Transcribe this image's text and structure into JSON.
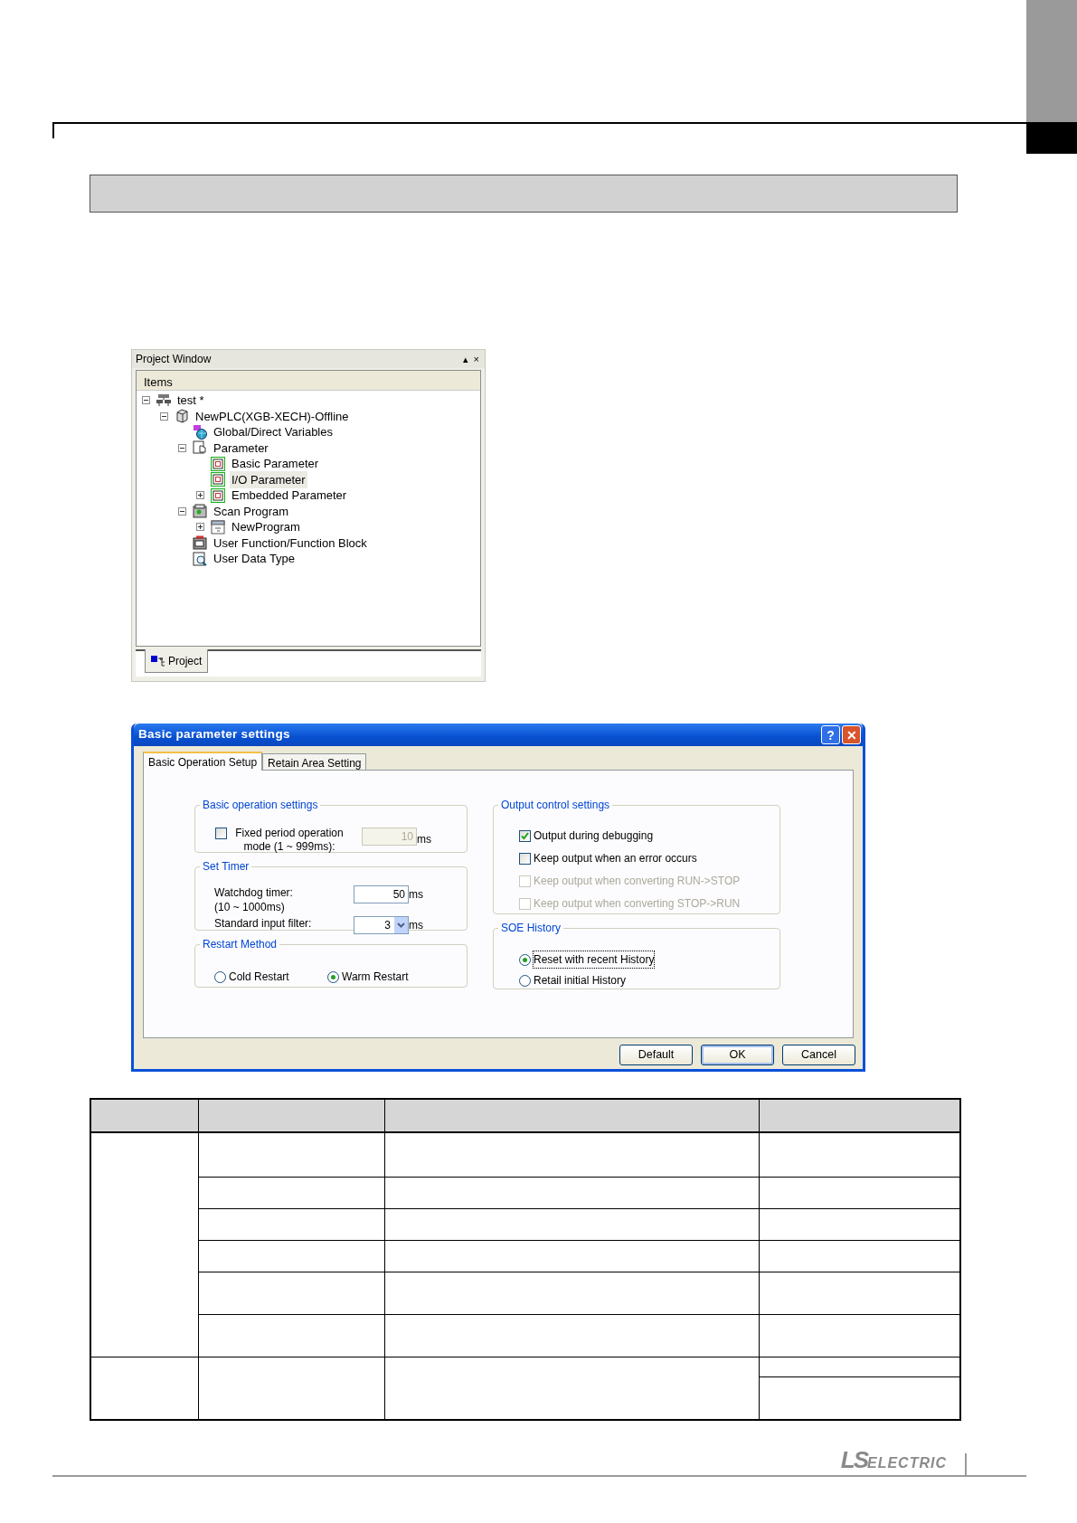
{
  "project_window": {
    "title": "Project Window",
    "controls": [
      "▴",
      "×"
    ],
    "column": "Items",
    "tree": [
      {
        "kind": "project",
        "label": "test *",
        "expanded": true,
        "selected": false,
        "children": [
          {
            "kind": "plc",
            "label": "NewPLC(XGB-XECH)-Offline",
            "expanded": true,
            "selected": false,
            "children": [
              {
                "kind": "variables",
                "label": "Global/Direct Variables",
                "selected": false
              },
              {
                "kind": "parameter",
                "label": "Parameter",
                "expanded": true,
                "selected": false,
                "children": [
                  {
                    "kind": "param",
                    "label": "Basic Parameter",
                    "selected": false
                  },
                  {
                    "kind": "param",
                    "label": "I/O Parameter",
                    "selected": true
                  },
                  {
                    "kind": "param",
                    "label": "Embedded Parameter",
                    "expanded": false,
                    "selected": false
                  }
                ]
              },
              {
                "kind": "program_folder",
                "label": "Scan Program",
                "expanded": true,
                "selected": false,
                "children": [
                  {
                    "kind": "program",
                    "label": "NewProgram",
                    "expanded": false,
                    "selected": false
                  }
                ]
              },
              {
                "kind": "function_block",
                "label": "User Function/Function Block",
                "selected": false
              },
              {
                "kind": "data_type",
                "label": "User Data Type",
                "selected": false
              }
            ]
          }
        ]
      }
    ],
    "bottom_tab": "Project"
  },
  "dialog": {
    "title": "Basic parameter settings",
    "title_buttons": [
      "?",
      "✕"
    ],
    "tabs": [
      {
        "label": "Basic Operation Setup",
        "selected": true
      },
      {
        "label": "Retain Area Setting",
        "selected": false
      }
    ],
    "basic_operation": {
      "title": "Basic operation settings",
      "checkbox": {
        "label": "Fixed period operation mode (1 ~ 999ms):",
        "checked": false
      },
      "field": {
        "value": "10",
        "disabled": true,
        "unit": "ms"
      }
    },
    "set_timer": {
      "title": "Set Timer",
      "fields": [
        {
          "kind": "text",
          "label": "Watchdog timer:",
          "note": "(10 ~ 1000ms)",
          "value": "50",
          "unit": "ms"
        },
        {
          "kind": "combo",
          "label": "Standard input filter:",
          "value": "3",
          "unit": "ms"
        }
      ]
    },
    "restart_method": {
      "title": "Restart Method",
      "options": [
        {
          "label": "Cold Restart",
          "selected": false
        },
        {
          "label": "Warm Restart",
          "selected": true
        }
      ]
    },
    "output_control": {
      "title": "Output control settings",
      "options": [
        {
          "label": "Output during debugging",
          "checked": true,
          "disabled": false
        },
        {
          "label": "Keep output when an error occurs",
          "checked": false,
          "disabled": false
        },
        {
          "label": "Keep output when converting RUN->STOP",
          "checked": false,
          "disabled": true
        },
        {
          "label": "Keep output when converting STOP->RUN",
          "checked": false,
          "disabled": true
        }
      ]
    },
    "soe_history": {
      "title": "SOE History",
      "options": [
        {
          "label": "Reset with recent History",
          "selected": true,
          "focused": true
        },
        {
          "label": "Retail initial History",
          "selected": false,
          "focused": false
        }
      ]
    },
    "buttons": [
      {
        "label": "Default",
        "is_default": false
      },
      {
        "label": "OK",
        "is_default": true
      },
      {
        "label": "Cancel",
        "is_default": false
      }
    ]
  },
  "footer": {
    "logo_ls": "LS",
    "logo_electric": "ELECTRIC"
  }
}
